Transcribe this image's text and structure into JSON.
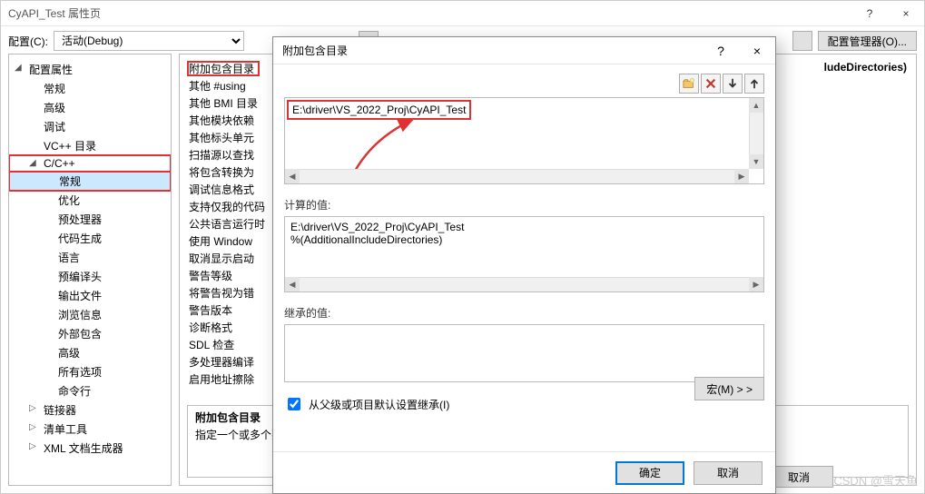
{
  "window": {
    "title": "CyAPI_Test 属性页",
    "help_icon": "?",
    "close_icon": "×"
  },
  "config_bar": {
    "label": "配置(C):",
    "config_value": "活动(Debug)",
    "manager_btn": "配置管理器(O)..."
  },
  "tree": {
    "root": "配置属性",
    "items": [
      "常规",
      "高级",
      "调试",
      "VC++ 目录"
    ],
    "ccpp": "C/C++",
    "ccpp_items": [
      "常规",
      "优化",
      "预处理器",
      "代码生成",
      "语言",
      "预编译头",
      "输出文件",
      "浏览信息",
      "外部包含",
      "高级",
      "所有选项",
      "命令行"
    ],
    "after": [
      "链接器",
      "清单工具",
      "XML 文档生成器"
    ]
  },
  "props": {
    "rows": [
      "附加包含目录",
      "其他 #using",
      "其他 BMI 目录",
      "其他模块依赖",
      "其他标头单元",
      "扫描源以查找",
      "将包含转换为",
      "调试信息格式",
      "支持仅我的代码",
      "公共语言运行时",
      "使用 Window",
      "取消显示启动",
      "警告等级",
      "将警告视为错",
      "警告版本",
      "诊断格式",
      "SDL 检查",
      "多处理器编译",
      "启用地址擦除"
    ],
    "right_value": "ludeDirectories)"
  },
  "desc": {
    "heading": "附加包含目录",
    "text": "指定一个或多个要"
  },
  "dialog": {
    "title": "附加包含目录",
    "help_icon": "?",
    "close_icon": "×",
    "path_value": "E:\\driver\\VS_2022_Proj\\CyAPI_Test",
    "calc_label": "计算的值:",
    "calc_line1": "E:\\driver\\VS_2022_Proj\\CyAPI_Test",
    "calc_line2": "%(AdditionalIncludeDirectories)",
    "inherit_label": "继承的值:",
    "inherit_check": "从父级或项目默认设置继承(I)",
    "macro_btn": "宏(M)  > >",
    "ok": "确定",
    "cancel": "取消"
  },
  "parent_footer": {
    "cancel": "取消"
  },
  "watermark": "CSDN @雪天鱼"
}
